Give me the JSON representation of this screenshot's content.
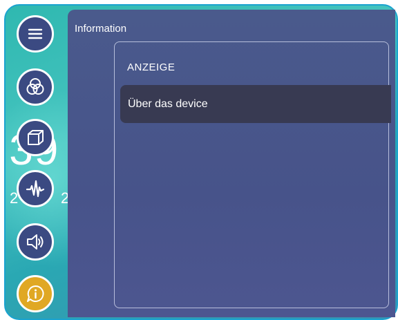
{
  "background": {
    "clock_text": ":39",
    "date_left": "2",
    "date_right": "20"
  },
  "sidebar": {
    "items": [
      {
        "icon": "menu-icon"
      },
      {
        "icon": "color-circles-icon"
      },
      {
        "icon": "cube-icon"
      },
      {
        "icon": "audio-wave-icon"
      },
      {
        "icon": "speaker-icon"
      },
      {
        "icon": "info-bubble-icon",
        "active": true
      }
    ]
  },
  "panel": {
    "title": "Information",
    "section_header": "ANZEIGE",
    "items": [
      {
        "label": "Über das device",
        "selected": true
      }
    ]
  },
  "colors": {
    "panel": "#47538a",
    "selected_item": "#383a52",
    "active_button": "#e0a824",
    "sidebar_button": "#3b4a82",
    "background_teal": "#2fb8b0"
  }
}
